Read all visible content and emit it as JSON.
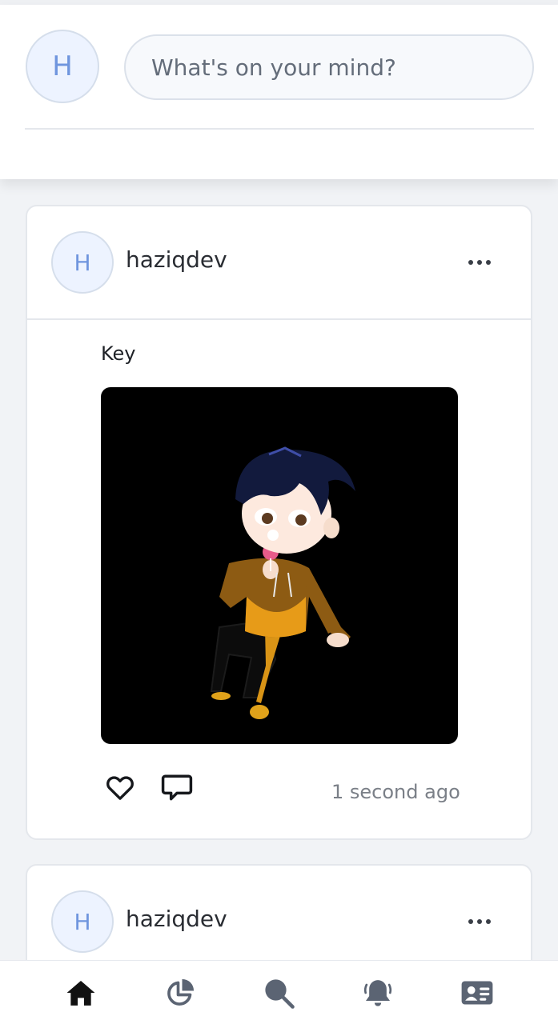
{
  "composer": {
    "avatar_initial": "H",
    "placeholder": "What's on your mind?"
  },
  "posts": [
    {
      "avatar_initial": "H",
      "username": "haziqdev",
      "text": "Key",
      "image_alt": "Chibi character in orange hoodie holding a lollipop",
      "timestamp": "1 second ago"
    },
    {
      "avatar_initial": "H",
      "username": "haziqdev"
    }
  ],
  "bottom_nav": {
    "items": [
      {
        "icon": "home-icon",
        "active": true
      },
      {
        "icon": "pie-chart-icon",
        "active": false
      },
      {
        "icon": "search-icon",
        "active": false
      },
      {
        "icon": "bell-icon",
        "active": false
      },
      {
        "icon": "profile-card-icon",
        "active": false
      }
    ]
  },
  "colors": {
    "accent_avatar_text": "#6f95de",
    "nav_active": "#111111",
    "nav_inactive": "#5b6473"
  }
}
